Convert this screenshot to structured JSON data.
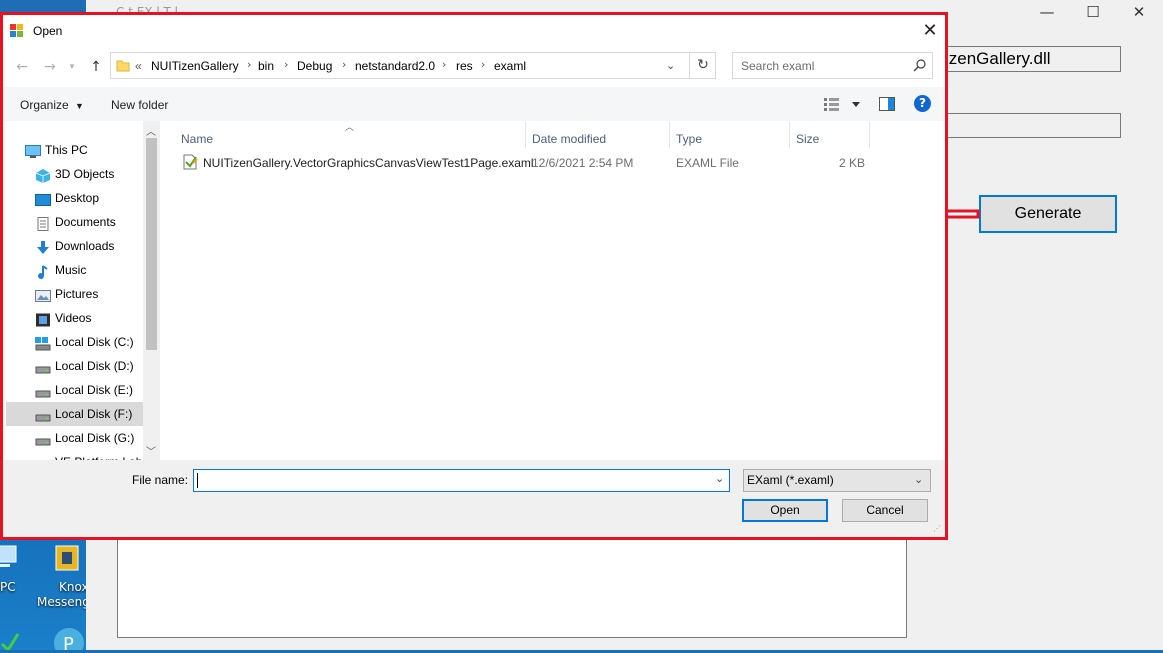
{
  "desktop": {
    "icons": [
      {
        "label": "PC"
      },
      {
        "label": "Knox"
      },
      {
        "label": "Messeng"
      }
    ]
  },
  "background_window": {
    "title": "C      t EX   l T   l",
    "minimize": "—",
    "maximize": "☐",
    "close": "✕",
    "dll_field_text": "izenGallery.dll",
    "generate_label": "Generate"
  },
  "dialog": {
    "title": "Open",
    "close": "✕",
    "breadcrumb": {
      "overflow": "«",
      "items": [
        "NUITizenGallery",
        "bin",
        "Debug",
        "netstandard2.0",
        "res",
        "examl"
      ]
    },
    "search_placeholder": "Search examl",
    "toolbar": {
      "organize": "Organize",
      "new_folder": "New folder",
      "help": "?"
    },
    "nav_items": [
      {
        "label": "This PC",
        "icon": "pc-icon"
      },
      {
        "label": "3D Objects",
        "icon": "3d-objects-icon"
      },
      {
        "label": "Desktop",
        "icon": "desktop-icon"
      },
      {
        "label": "Documents",
        "icon": "documents-icon"
      },
      {
        "label": "Downloads",
        "icon": "downloads-icon"
      },
      {
        "label": "Music",
        "icon": "music-icon"
      },
      {
        "label": "Pictures",
        "icon": "pictures-icon"
      },
      {
        "label": "Videos",
        "icon": "videos-icon"
      },
      {
        "label": "Local Disk (C:)",
        "icon": "drive-icon"
      },
      {
        "label": "Local Disk (D:)",
        "icon": "drive-icon"
      },
      {
        "label": "Local Disk (E:)",
        "icon": "drive-icon"
      },
      {
        "label": "Local Disk (F:)",
        "icon": "drive-icon",
        "selected": true
      },
      {
        "label": "Local Disk (G:)",
        "icon": "drive-icon"
      },
      {
        "label": "VE Platform Lab",
        "icon": "drive-icon"
      }
    ],
    "columns": {
      "name": "Name",
      "date": "Date modified",
      "type": "Type",
      "size": "Size"
    },
    "files": [
      {
        "name": "NUITizenGallery.VectorGraphicsCanvasViewTest1Page.examl",
        "date": "12/6/2021 2:54 PM",
        "type": "EXAML File",
        "size": "2 KB"
      }
    ],
    "file_name_label": "File name:",
    "file_name_value": "",
    "file_type": "EXaml (*.examl)",
    "open_label": "Open",
    "cancel_label": "Cancel"
  },
  "colors": {
    "highlight_border": "#e81123",
    "accent": "#0078d7"
  }
}
